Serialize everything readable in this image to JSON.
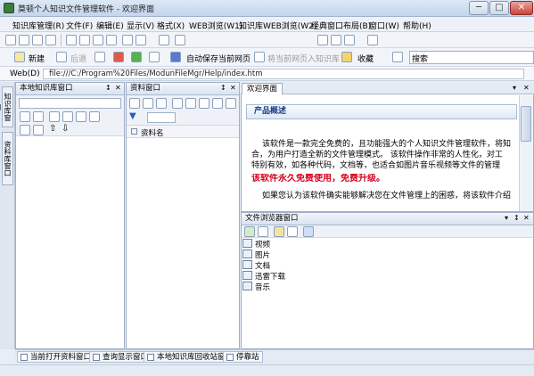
{
  "window": {
    "title": "莫顿个人知识文件管理软件 - 欢迎界面",
    "min_label": "─",
    "max_label": "□",
    "close_label": "✕"
  },
  "menu": {
    "items": [
      "知识库管理(R)",
      "文件(F)",
      "编辑(E)",
      "显示(V)",
      "格式(X)",
      "WEB浏览(W1)",
      "知识库WEB浏览(W2)",
      "经典窗口布局(B)",
      "窗口(W)",
      "帮助(H)"
    ]
  },
  "toolbar2": {
    "new_label": "新建",
    "back_label": "后退",
    "save_page_label": "自动保存当前网页",
    "add_to_kb_label": "将当前网页入知识库",
    "favorites_label": "收藏",
    "search_label": "搜索"
  },
  "address": {
    "label": "Web(D)",
    "value": "file:///C:/Program%20Files/ModunFileMgr/Help/index.htm"
  },
  "sidebar_tabs": [
    "知识库窗口",
    "资料库窗口"
  ],
  "panels": {
    "kb_window_title": "本地知识库窗口",
    "materials_title": "资料窗口",
    "materials_column": "资料名",
    "welcome_tab": "欢迎界面",
    "file_browser_title": "文件浏览器窗口",
    "pin_icon": "↕",
    "panel_close": "✕"
  },
  "welcome": {
    "heading": "产品概述",
    "p1_line1": "该软件是一款完全免费的，且功能强大的个人知识文件管理软件，将知",
    "p1_line2": "合，为用户打造全新的文件管理模式。 该软件操作非常的人性化，对工",
    "p1_line3": "特别有效，如各种代码，文档等，也适合如图片音乐视频等文件的管理",
    "free_notice": "该软件永久免费使用，免费升级。",
    "p2_line1": "如果您认为该软件确实能够解决您在文件管理上的困惑，将该软件介绍"
  },
  "file_tree": [
    "视频",
    "图片",
    "文档",
    "迅雷下载",
    "音乐"
  ],
  "bottom_tabs": [
    "当前打开资料窗口",
    "查询显示窗口",
    "本地知识库回收站窗口",
    "停靠站"
  ]
}
